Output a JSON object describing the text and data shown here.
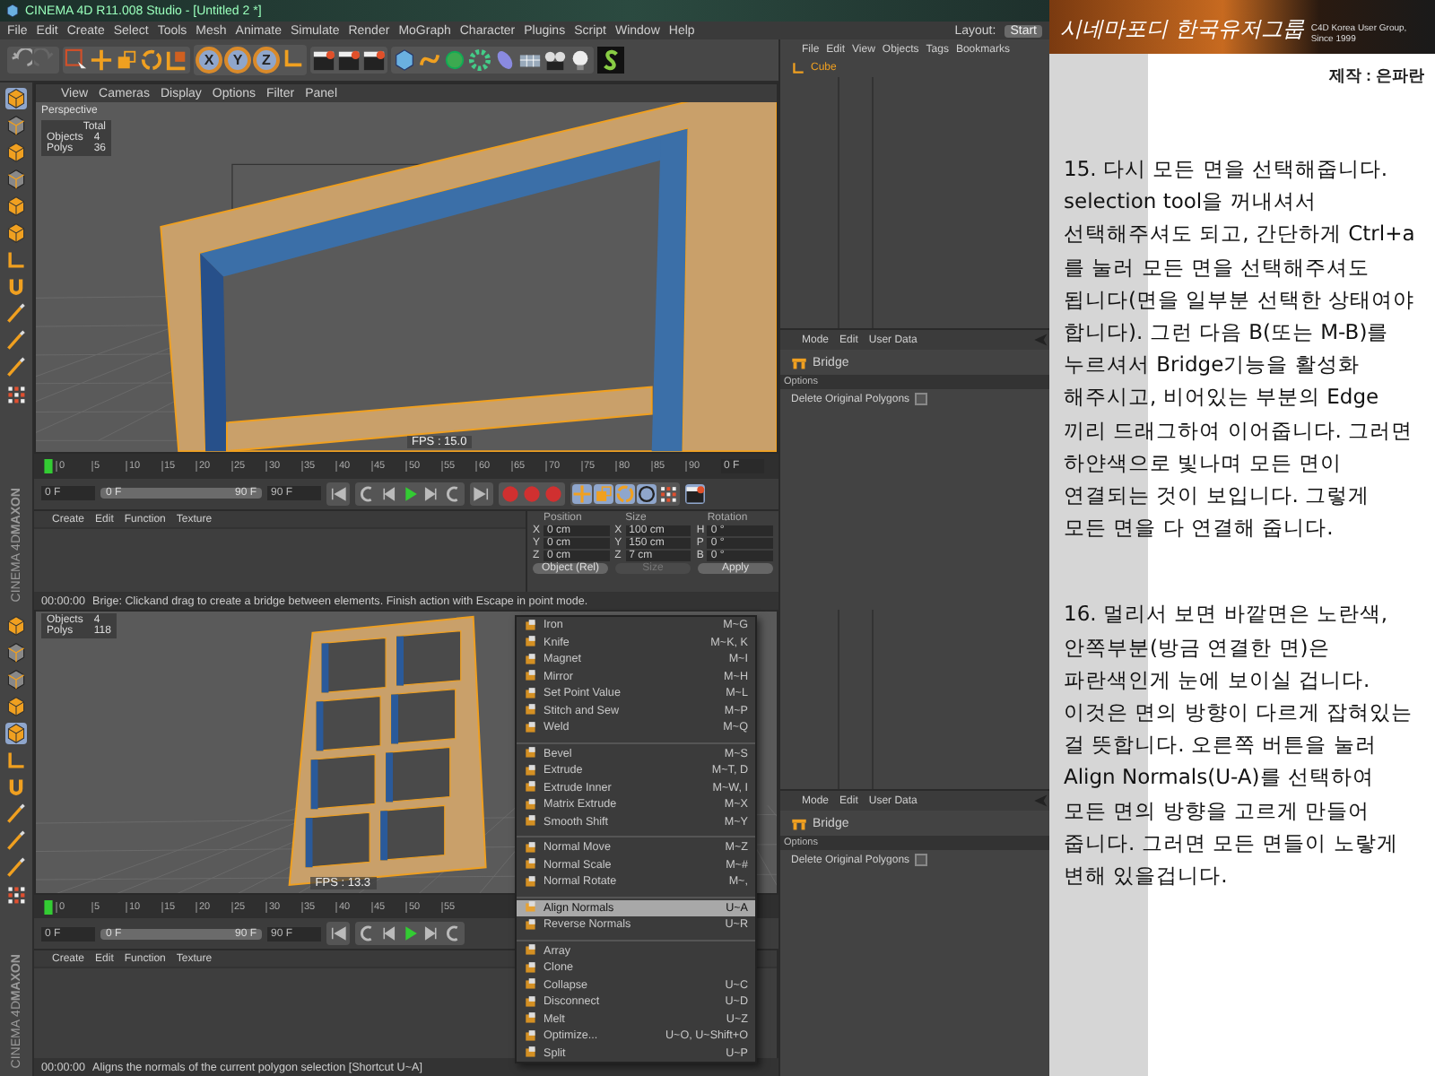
{
  "app": {
    "title": "CINEMA 4D R11.008 Studio - [Untitled 2 *]",
    "menu": [
      "File",
      "Edit",
      "Create",
      "Select",
      "Tools",
      "Mesh",
      "Animate",
      "Simulate",
      "Render",
      "MoGraph",
      "Character",
      "Plugins",
      "Script",
      "Window",
      "Help"
    ],
    "layout_label": "Layout:",
    "layout_value": "Start",
    "axis_buttons": [
      "X",
      "Y",
      "Z"
    ]
  },
  "screens": [
    {
      "viewport_menu": [
        "View",
        "Cameras",
        "Display",
        "Options",
        "Filter",
        "Panel"
      ],
      "viewport_label": "Perspective",
      "stats_title": "Total",
      "stats": [
        {
          "label": "Objects",
          "value": "4"
        },
        {
          "label": "Polys",
          "value": "36"
        }
      ],
      "fps": "FPS : 15.0",
      "kind": "single",
      "ticks": [
        "0",
        "5",
        "10",
        "15",
        "20",
        "25",
        "30",
        "35",
        "40",
        "45",
        "50",
        "55",
        "60",
        "65",
        "70",
        "75",
        "80",
        "85",
        "90"
      ],
      "timeline_end": "0 F",
      "transport": {
        "start": "0 F",
        "range_from": "0 F",
        "range_to": "90 F",
        "level": 1,
        "end": "90 F",
        "key_tools": true
      },
      "material_menu": [
        "Create",
        "Edit",
        "Function",
        "Texture"
      ],
      "coordinates": {
        "headers": [
          "Position",
          "Size",
          "Rotation"
        ],
        "rows": [
          [
            {
              "axis": "X",
              "value": "0 cm"
            },
            {
              "axis": "X",
              "value": "100 cm"
            },
            {
              "axis": "H",
              "value": "0 °"
            }
          ],
          [
            {
              "axis": "Y",
              "value": "0 cm"
            },
            {
              "axis": "Y",
              "value": "150 cm"
            },
            {
              "axis": "P",
              "value": "0 °"
            }
          ],
          [
            {
              "axis": "Z",
              "value": "0 cm"
            },
            {
              "axis": "Z",
              "value": "7 cm"
            },
            {
              "axis": "B",
              "value": "0 °"
            }
          ]
        ],
        "mode": "Object (Rel)",
        "size_mode": "Size",
        "apply": "Apply"
      },
      "status_time": "00:00:00",
      "status": "Brige: Clickand drag to create a bridge between elements. Finish action with Escape in point mode.",
      "brand": [
        "MAXON",
        "CINEMA 4D"
      ],
      "object_manager": {
        "menu": [
          "File",
          "Edit",
          "View",
          "Objects",
          "Tags",
          "Bookmarks"
        ],
        "object": "Cube"
      },
      "attribute_manager": {
        "menu": [
          "Mode",
          "Edit",
          "User Data"
        ],
        "tool": "Bridge",
        "section": "Options",
        "option": {
          "label": "Delete Original Polygons",
          "checked": false
        }
      }
    },
    {
      "stats": [
        {
          "label": "Objects",
          "value": "4"
        },
        {
          "label": "Polys",
          "value": "118"
        }
      ],
      "fps": "FPS : 13.3",
      "kind": "grid",
      "ticks": [
        "0",
        "5",
        "10",
        "15",
        "20",
        "25",
        "30",
        "35",
        "40",
        "45",
        "50",
        "55"
      ],
      "transport": {
        "start": "0 F",
        "range_from": "0 F",
        "range_to": "90 F",
        "level": 1,
        "end": "90 F",
        "key_tools": false
      },
      "material_menu": [
        "Create",
        "Edit",
        "Function",
        "Texture"
      ],
      "status_time": "00:00:00",
      "status": "Aligns the normals of the current polygon selection [Shortcut U~A]",
      "brand": [
        "MAXON",
        "CINEMA 4D"
      ],
      "attribute_manager": {
        "menu": [
          "Mode",
          "Edit",
          "User Data"
        ],
        "tool": "Bridge",
        "section": "Options",
        "option": {
          "label": "Delete Original Polygons",
          "checked": false
        }
      },
      "context_menu": [
        {
          "kind": "item",
          "label": "Iron",
          "shortcut": "M~G",
          "selected": false
        },
        {
          "kind": "item",
          "label": "Knife",
          "shortcut": "M~K, K",
          "selected": false
        },
        {
          "kind": "item",
          "label": "Magnet",
          "shortcut": "M~I",
          "selected": false
        },
        {
          "kind": "item",
          "label": "Mirror",
          "shortcut": "M~H",
          "selected": false
        },
        {
          "kind": "item",
          "label": "Set Point Value",
          "shortcut": "M~L",
          "selected": false
        },
        {
          "kind": "item",
          "label": "Stitch and Sew",
          "shortcut": "M~P",
          "selected": false
        },
        {
          "kind": "item",
          "label": "Weld",
          "shortcut": "M~Q",
          "selected": false
        },
        {
          "kind": "separator"
        },
        {
          "kind": "item",
          "label": "Bevel",
          "shortcut": "M~S",
          "selected": false
        },
        {
          "kind": "item",
          "label": "Extrude",
          "shortcut": "M~T, D",
          "selected": false
        },
        {
          "kind": "item",
          "label": "Extrude Inner",
          "shortcut": "M~W, I",
          "selected": false
        },
        {
          "kind": "item",
          "label": "Matrix Extrude",
          "shortcut": "M~X",
          "selected": false
        },
        {
          "kind": "item",
          "label": "Smooth Shift",
          "shortcut": "M~Y",
          "selected": false
        },
        {
          "kind": "separator"
        },
        {
          "kind": "item",
          "label": "Normal Move",
          "shortcut": "M~Z",
          "selected": false
        },
        {
          "kind": "item",
          "label": "Normal Scale",
          "shortcut": "M~#",
          "selected": false
        },
        {
          "kind": "item",
          "label": "Normal Rotate",
          "shortcut": "M~,",
          "selected": false
        },
        {
          "kind": "separator"
        },
        {
          "kind": "item",
          "label": "Align Normals",
          "shortcut": "U~A",
          "selected": true
        },
        {
          "kind": "item",
          "label": "Reverse Normals",
          "shortcut": "U~R",
          "selected": false
        },
        {
          "kind": "separator"
        },
        {
          "kind": "item",
          "label": "Array",
          "selected": false
        },
        {
          "kind": "item",
          "label": "Clone",
          "selected": false
        },
        {
          "kind": "item",
          "label": "Collapse",
          "shortcut": "U~C",
          "selected": false
        },
        {
          "kind": "item",
          "label": "Disconnect",
          "shortcut": "U~D",
          "selected": false
        },
        {
          "kind": "item",
          "label": "Melt",
          "shortcut": "U~Z",
          "selected": false
        },
        {
          "kind": "item",
          "label": "Optimize...",
          "shortcut": "U~O, U~Shift+O",
          "selected": false
        },
        {
          "kind": "item",
          "label": "Split",
          "shortcut": "U~P",
          "selected": false
        }
      ]
    }
  ],
  "article": {
    "banner_title": "시네마포디 한국유저그룹",
    "banner_subtitle": "C4D Korea User Group, Since 1999",
    "credit": "제작 : 은파란",
    "paragraphs": [
      {
        "lines": [
          "15. 다시 모든 면을 선택해줍니다.",
          "selection tool을 꺼내셔서",
          "선택해주셔도 되고, 간단하게 Ctrl+a",
          "를 눌러 모든 면을 선택해주셔도",
          "됩니다(면을 일부분 선택한 상태여야",
          "합니다). 그런 다음 B(또는 M-B)를",
          "누르셔서 Bridge기능을 활성화",
          "해주시고, 비어있는 부분의 Edge",
          "끼리 드래그하여 이어줍니다. 그러면",
          "하얀색으로 빛나며 모든 면이",
          "연결되는 것이 보입니다. 그렇게",
          "모든 면을 다 연결해 줍니다."
        ]
      },
      {
        "lines": [
          "16. 멀리서 보면 바깥면은 노란색,",
          "안쪽부분(방금 연결한 면)은",
          "파란색인게 눈에 보이실 겁니다.",
          "이것은 면의 방향이 다르게 잡혀있는",
          "걸 뜻합니다. 오른쪽 버튼을 눌러",
          "Align Normals(U-A)를 선택하여",
          "모든 면의 방향을 고르게 만들어",
          "줍니다. 그러면 모든 면들이 노랗게",
          "변해 있을겁니다."
        ]
      }
    ]
  }
}
